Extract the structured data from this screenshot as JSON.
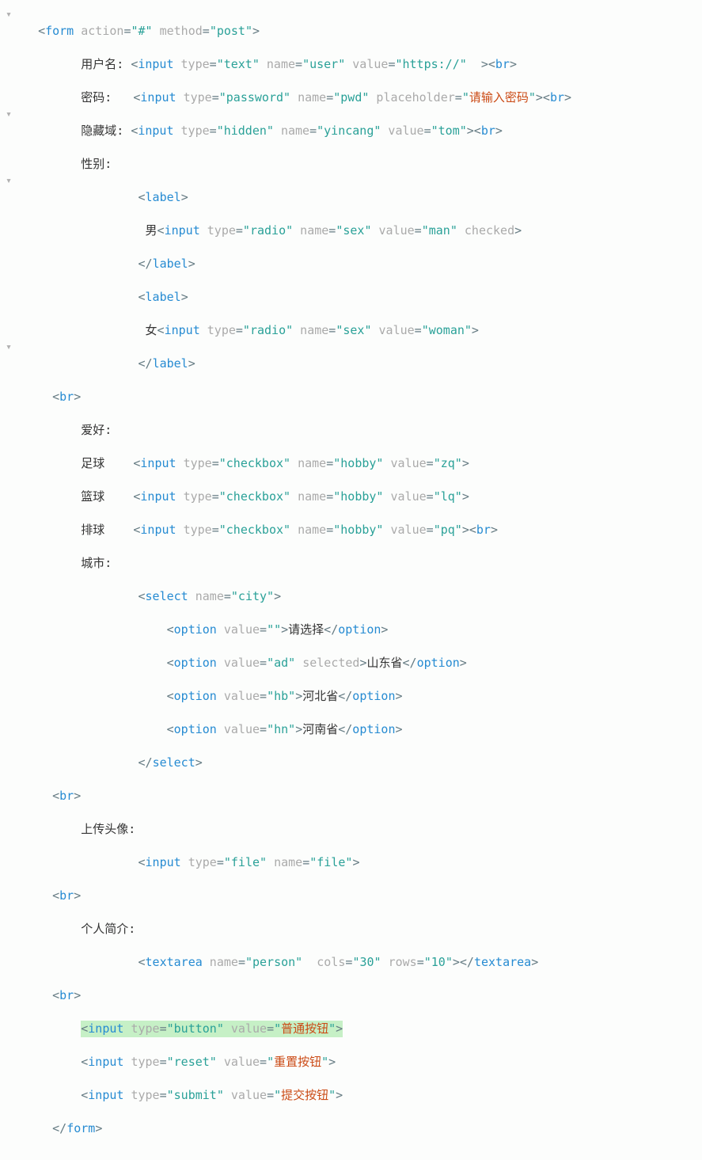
{
  "gutter": {
    "l1": "▾",
    "l7": "▾",
    "l11": "▾",
    "l21": "▾"
  },
  "lines": {
    "l1": {
      "ind": "  ",
      "pre": "<",
      "tag": "form",
      "a": " action",
      "v1": "\"#\"",
      "b": " method",
      "v2": "\"post\"",
      "suf": ">"
    },
    "l2": {
      "ind": "        ",
      "txt": "用户名: ",
      "pre": "<",
      "tag": "input",
      "a1": " type",
      "v1": "\"text\"",
      "a2": " name",
      "v2": "\"user\"",
      "a3": " value",
      "v3": "\"https://\"",
      "suf": "  ><",
      "tag2": "br",
      "suf2": ">"
    },
    "l3": {
      "ind": "        ",
      "txt": "密码:   ",
      "pre": "<",
      "tag": "input",
      "a1": " type",
      "v1": "\"password\"",
      "a2": " name",
      "v2": "\"pwd\"",
      "a3": " placeholder",
      "v3": "\"",
      "orange": "请输入密码",
      "v3b": "\"",
      "suf": "><",
      "tag2": "br",
      "suf2": ">"
    },
    "l4": {
      "ind": "        ",
      "txt": "隐藏域: ",
      "pre": "<",
      "tag": "input",
      "a1": " type",
      "v1": "\"hidden\"",
      "a2": " name",
      "v2": "\"yincang\"",
      "a3": " value",
      "v3": "\"tom\"",
      "suf": "><",
      "tag2": "br",
      "suf2": ">"
    },
    "l5": {
      "ind": "        ",
      "txt": "性别:"
    },
    "l6": {
      "ind": "                ",
      "pre": "<",
      "tag": "label",
      "suf": ">"
    },
    "l7": {
      "ind": "                 ",
      "txt": "男",
      "pre": "<",
      "tag": "input",
      "a1": " type",
      "v1": "\"radio\"",
      "a2": " name",
      "v2": "\"sex\"",
      "a3": " value",
      "v3": "\"man\"",
      "a4": " checked",
      "suf": ">"
    },
    "l8": {
      "ind": "                ",
      "pre": "</",
      "tag": "label",
      "suf": ">"
    },
    "l9": {
      "ind": "                ",
      "pre": "<",
      "tag": "label",
      "suf": ">"
    },
    "l10": {
      "ind": "                 ",
      "txt": "女",
      "pre": "<",
      "tag": "input",
      "a1": " type",
      "v1": "\"radio\"",
      "a2": " name",
      "v2": "\"sex\"",
      "a3": " value",
      "v3": "\"woman\"",
      "suf": ">"
    },
    "l11": {
      "ind": "                ",
      "pre": "</",
      "tag": "label",
      "suf": ">"
    },
    "l12": {
      "ind": "    ",
      "pre": "<",
      "tag": "br",
      "suf": ">"
    },
    "l13": {
      "ind": "        ",
      "txt": "爱好:"
    },
    "l14": {
      "ind": "        ",
      "txt": "足球    ",
      "pre": "<",
      "tag": "input",
      "a1": " type",
      "v1": "\"checkbox\"",
      "a2": " name",
      "v2": "\"hobby\"",
      "a3": " value",
      "v3": "\"zq\"",
      "suf": ">"
    },
    "l15": {
      "ind": "        ",
      "txt": "篮球    ",
      "pre": "<",
      "tag": "input",
      "a1": " type",
      "v1": "\"checkbox\"",
      "a2": " name",
      "v2": "\"hobby\"",
      "a3": " value",
      "v3": "\"lq\"",
      "suf": ">"
    },
    "l16": {
      "ind": "        ",
      "txt": "排球    ",
      "pre": "<",
      "tag": "input",
      "a1": " type",
      "v1": "\"checkbox\"",
      "a2": " name",
      "v2": "\"hobby\"",
      "a3": " value",
      "v3": "\"pq\"",
      "suf": "><",
      "tag2": "br",
      "suf2": ">"
    },
    "l17": {
      "ind": "        ",
      "txt": "城市:"
    },
    "l18": {
      "ind": "                ",
      "pre": "<",
      "tag": "select",
      "a1": " name",
      "v1": "\"city\"",
      "suf": ">"
    },
    "l19": {
      "ind": "                    ",
      "pre": "<",
      "tag": "option",
      "a1": " value",
      "v1": "\"\"",
      "mid": ">",
      "txt": "请选择",
      "pre2": "</",
      "tag2": "option",
      "suf": ">"
    },
    "l20": {
      "ind": "                    ",
      "pre": "<",
      "tag": "option",
      "a1": " value",
      "v1": "\"ad\"",
      "a2": " selected",
      "mid": ">",
      "txt": "山东省",
      "pre2": "</",
      "tag2": "option",
      "suf": ">"
    },
    "l21": {
      "ind": "                    ",
      "pre": "<",
      "tag": "option",
      "a1": " value",
      "v1": "\"hb\"",
      "mid": ">",
      "txt": "河北省",
      "pre2": "</",
      "tag2": "option",
      "suf": ">"
    },
    "l22": {
      "ind": "                    ",
      "pre": "<",
      "tag": "option",
      "a1": " value",
      "v1": "\"hn\"",
      "mid": ">",
      "txt": "河南省",
      "pre2": "</",
      "tag2": "option",
      "suf": ">"
    },
    "l23": {
      "ind": "                ",
      "pre": "</",
      "tag": "select",
      "suf": ">"
    },
    "l24": {
      "ind": "    ",
      "pre": "<",
      "tag": "br",
      "suf": ">"
    },
    "l25": {
      "ind": "        ",
      "txt": "上传头像:"
    },
    "l26": {
      "ind": "                ",
      "pre": "<",
      "tag": "input",
      "a1": " type",
      "v1": "\"file\"",
      "a2": " name",
      "v2": "\"file\"",
      "suf": ">"
    },
    "l27": {
      "ind": "    ",
      "pre": "<",
      "tag": "br",
      "suf": ">"
    },
    "l28": {
      "ind": "        ",
      "txt": "个人简介:"
    },
    "l29": {
      "ind": "                ",
      "pre": "<",
      "tag": "textarea",
      "a1": " name",
      "v1": "\"person\"",
      "a2": "  cols",
      "v2": "\"30\"",
      "a3": " rows",
      "v3": "\"10\"",
      "mid": "></",
      "tag2": "textarea",
      "suf": ">"
    },
    "l30": {
      "ind": "    ",
      "pre": "<",
      "tag": "br",
      "suf": ">"
    },
    "l31": {
      "ind": "        ",
      "pre": "<",
      "tag": "input",
      "a1": " type",
      "v1": "\"button\"",
      "a2": " value",
      "v2": "\"",
      "orange": "普通按钮",
      "v2b": "\"",
      "suf": ">"
    },
    "l32": {
      "ind": "        ",
      "pre": "<",
      "tag": "input",
      "a1": " type",
      "v1": "\"reset\"",
      "a2": " value",
      "v2": "\"",
      "orange": "重置按钮",
      "v2b": "\"",
      "suf": ">"
    },
    "l33": {
      "ind": "        ",
      "pre": "<",
      "tag": "input",
      "a1": " type",
      "v1": "\"submit\"",
      "a2": " value",
      "v2": "\"",
      "orange": "提交按钮",
      "v2b": "\"",
      "suf": ">"
    },
    "l34": {
      "ind": "    ",
      "pre": "</",
      "tag": "form",
      "suf": ">"
    }
  }
}
